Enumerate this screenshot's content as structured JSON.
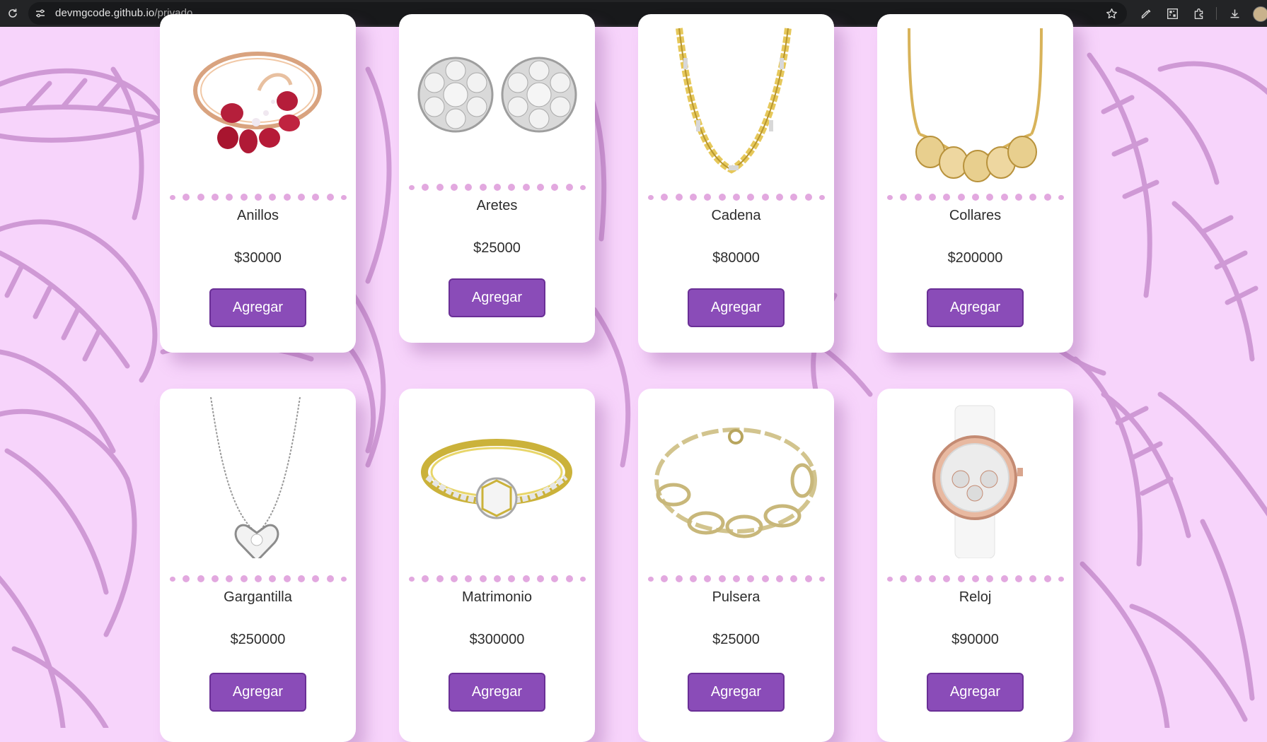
{
  "browser": {
    "url_host": "devmgcode.github.io",
    "url_path": "/privado",
    "icons": [
      "reload-icon",
      "site-info-icon",
      "star-icon",
      "eyedropper-icon",
      "qr-icon",
      "extensions-icon",
      "download-icon",
      "avatar"
    ]
  },
  "colors": {
    "background": "#f7d4fb",
    "leaf_stroke": "#c98fcf",
    "button": "#8a4cb8",
    "dot": "#e2a8df"
  },
  "button_label": "Agregar",
  "products": [
    {
      "name": "Anillos",
      "price": "$30000",
      "button": "Agregar",
      "image": "ruby-ring"
    },
    {
      "name": "Aretes",
      "price": "$25000",
      "button": "Agregar",
      "image": "diamond-earrings"
    },
    {
      "name": "Cadena",
      "price": "$80000",
      "button": "Agregar",
      "image": "gold-chain"
    },
    {
      "name": "Collares",
      "price": "$200000",
      "button": "Agregar",
      "image": "gold-filigree-necklace"
    },
    {
      "name": "Gargantilla",
      "price": "$250000",
      "button": "Agregar",
      "image": "heart-pendant-necklace"
    },
    {
      "name": "Matrimonio",
      "price": "$300000",
      "button": "Agregar",
      "image": "gold-engagement-ring"
    },
    {
      "name": "Pulsera",
      "price": "$25000",
      "button": "Agregar",
      "image": "gold-link-bracelet"
    },
    {
      "name": "Reloj",
      "price": "$90000",
      "button": "Agregar",
      "image": "rose-gold-watch"
    }
  ]
}
